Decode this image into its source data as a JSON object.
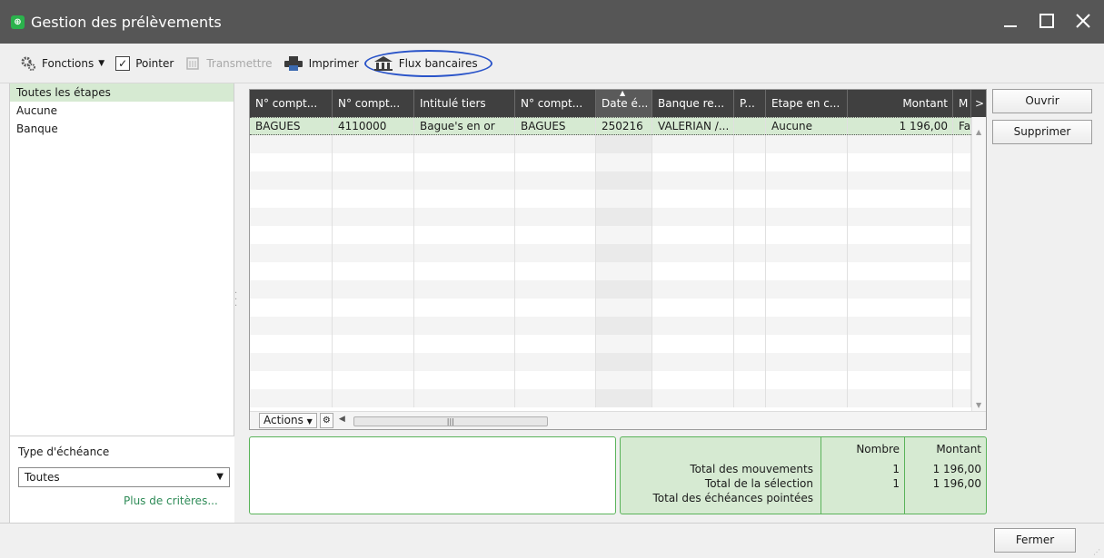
{
  "window": {
    "title": "Gestion des prélèvements",
    "app_icon_glyph": "⊕"
  },
  "toolbar": {
    "fonctions_label": "Fonctions",
    "pointer_label": "Pointer",
    "transmettre_label": "Transmettre",
    "imprimer_label": "Imprimer",
    "flux_label": "Flux bancaires"
  },
  "etapes": [
    "Toutes les étapes",
    "Aucune",
    "Banque"
  ],
  "filter": {
    "type_label": "Type d'échéance",
    "type_value": "Toutes",
    "plus_criteres": "Plus de critères..."
  },
  "grid": {
    "columns": [
      "N° compt...",
      "N° compt...",
      "Intitulé tiers",
      "N° compt...",
      "Date é...",
      "Banque re...",
      "P...",
      "Etape en c...",
      "Montant",
      "M"
    ],
    "rows": [
      [
        "BAGUES",
        "4110000",
        "Bague's en or",
        "BAGUES",
        "250216",
        "VALERIAN /...",
        "",
        "Aucune",
        "1 196,00",
        "Fa"
      ]
    ],
    "actions_label": "Actions",
    "more_glyph": ">"
  },
  "buttons": {
    "ouvrir": "Ouvrir",
    "supprimer": "Supprimer",
    "fermer": "Fermer"
  },
  "summary": {
    "header_nombre": "Nombre",
    "header_montant": "Montant",
    "rows": [
      {
        "label": "Total des mouvements",
        "nombre": "1",
        "montant": "1 196,00"
      },
      {
        "label": "Total de la sélection",
        "nombre": "1",
        "montant": "1 196,00"
      },
      {
        "label": "Total des échéances pointées",
        "nombre": "",
        "montant": ""
      }
    ]
  },
  "colors": {
    "title_bar": "#565656",
    "grid_header": "#404040",
    "selection": "#d6ead2",
    "summary_border": "#5ab35a",
    "highlight_circle": "#2a54c9"
  }
}
